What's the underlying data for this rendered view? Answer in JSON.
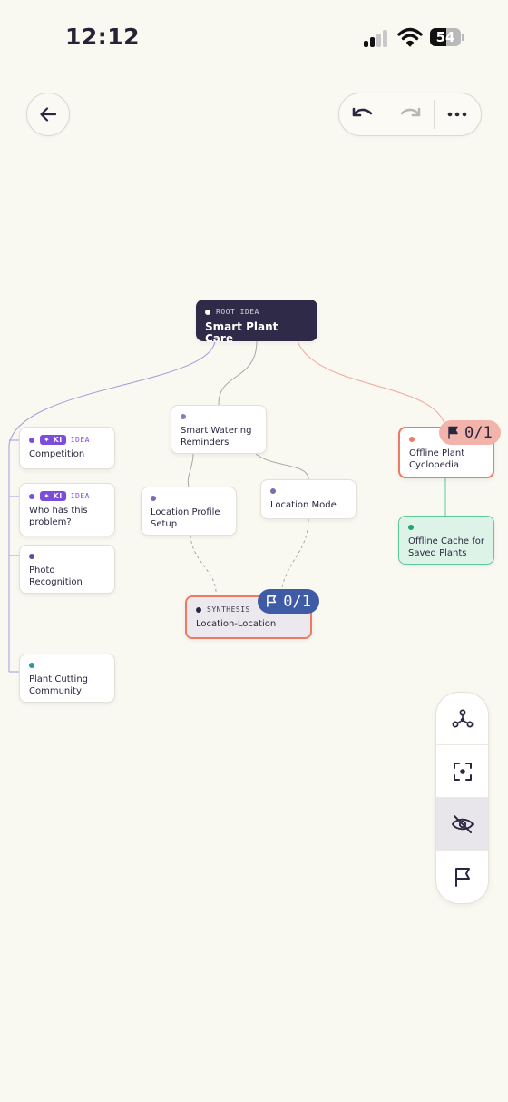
{
  "status_bar": {
    "time": "12:12",
    "battery": "54",
    "battery_level": 0.54
  },
  "nav": {
    "back_icon": "arrow-left-icon",
    "undo_icon": "undo-icon",
    "redo_icon": "redo-icon",
    "more_icon": "more-horizontal-icon"
  },
  "nodes": {
    "root": {
      "tag": "ROOT IDEA",
      "title": "Smart Plant Care"
    },
    "competition": {
      "badge": "KI",
      "tag": "IDEA",
      "title": "Competition"
    },
    "who_problem": {
      "badge": "KI",
      "tag": "IDEA",
      "title": "Who has this problem?"
    },
    "photo_recognition": {
      "title": "Photo Recognition"
    },
    "plant_cutting": {
      "title": "Plant Cutting Community"
    },
    "smart_watering": {
      "title": "Smart Watering Reminders"
    },
    "location_profile": {
      "title": "Location Profile Setup"
    },
    "location_mode": {
      "title": "Location Mode"
    },
    "synthesis": {
      "tag": "SYNTHESIS",
      "title": "Location-Location",
      "flag_count": "0/1"
    },
    "offline_cyclopedia": {
      "title": "Offline Plant Cyclopedia",
      "flag_count": "0/1"
    },
    "offline_cache": {
      "title": "Offline Cache for Saved Plants"
    }
  },
  "colors": {
    "background": "#f9f8f1",
    "root": "#2e2a48",
    "accent_purple": "#7c4ddb",
    "highlight_border": "#ef7a64",
    "synthesis_badge": "#3f5ba6",
    "offline_badge": "#f2b3ab",
    "cache_fill": "#ddf3e8",
    "cache_border": "#5cc99a"
  },
  "toolbar": {
    "items": [
      {
        "icon": "graph-nodes-icon",
        "active": false
      },
      {
        "icon": "focus-frame-icon",
        "active": false
      },
      {
        "icon": "eye-off-icon",
        "active": true
      },
      {
        "icon": "flag-icon",
        "active": false
      }
    ]
  }
}
